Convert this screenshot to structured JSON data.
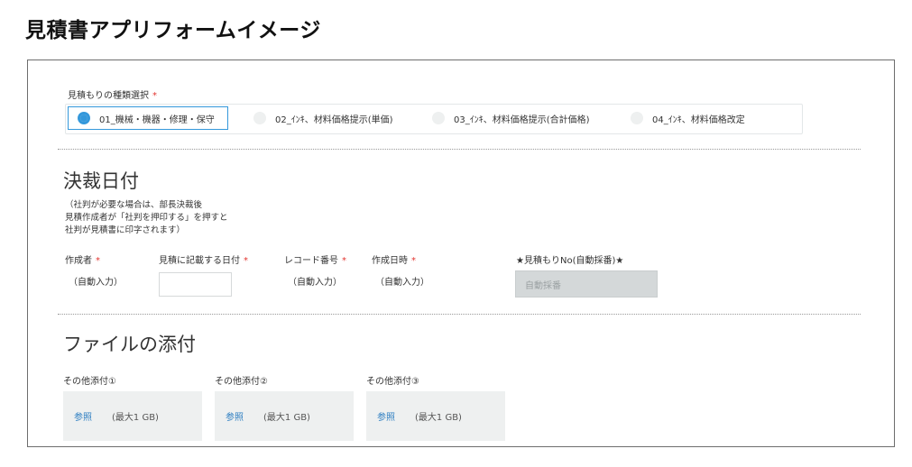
{
  "page_title": "見積書アプリフォームイメージ",
  "quote_type": {
    "label": "見積もりの種類選択",
    "required_mark": "*",
    "options": [
      {
        "label": "01_機械・機器・修理・保守",
        "selected": true
      },
      {
        "label": "02_ｲﾝｷ、材料価格提示(単価)",
        "selected": false
      },
      {
        "label": "03_ｲﾝｷ、材料価格提示(合計価格)",
        "selected": false
      },
      {
        "label": "04_ｲﾝｷ、材料価格改定",
        "selected": false
      }
    ]
  },
  "approval_section": {
    "title": "決裁日付",
    "note_lines": [
      "（社判が必要な場合は、部長決裁後",
      "見積作成者が「社判を押印する」を押すと",
      "社判が見積書に印字されます）"
    ],
    "fields": {
      "creator": {
        "label": "作成者",
        "required_mark": "*",
        "value": "（自動入力）"
      },
      "quote_date": {
        "label": "見積に記載する日付",
        "required_mark": "*",
        "value": ""
      },
      "record_number": {
        "label": "レコード番号",
        "required_mark": "*",
        "value": "（自動入力）"
      },
      "created_at": {
        "label": "作成日時",
        "required_mark": "*",
        "value": "（自動入力）"
      },
      "quote_no": {
        "label": "★見積もりNo(自動採番)★",
        "placeholder": "自動採番"
      }
    }
  },
  "attachments_section": {
    "title": "ファイルの添付",
    "items": [
      {
        "label": "その他添付①",
        "browse": "参照",
        "limit": "(最大1 GB)"
      },
      {
        "label": "その他添付②",
        "browse": "参照",
        "limit": "(最大1 GB)"
      },
      {
        "label": "その他添付③",
        "browse": "参照",
        "limit": "(最大1 GB)"
      }
    ]
  },
  "colors": {
    "accent": "#3498db",
    "required": "#e3342f",
    "link": "#2f7fc2",
    "auto_field_bg": "#d4d8d9",
    "attachment_bg": "#eef0f0"
  }
}
